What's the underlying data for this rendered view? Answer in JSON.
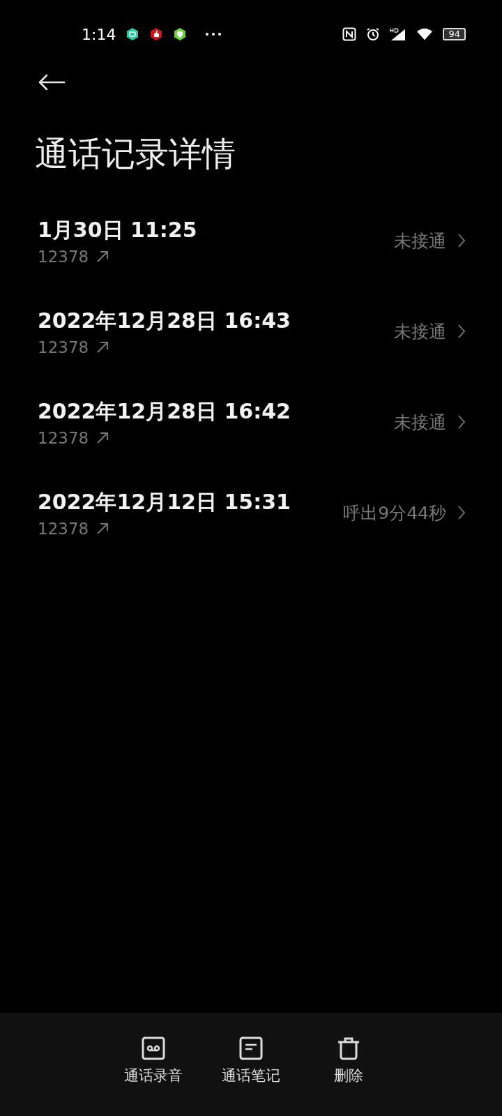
{
  "status_bar": {
    "time": "1:14",
    "battery": "94"
  },
  "title": "通话记录详情",
  "calls": [
    {
      "datetime": "1月30日 11:25",
      "number": "12378",
      "status": "未接通"
    },
    {
      "datetime": "2022年12月28日 16:43",
      "number": "12378",
      "status": "未接通"
    },
    {
      "datetime": "2022年12月28日 16:42",
      "number": "12378",
      "status": "未接通"
    },
    {
      "datetime": "2022年12月12日 15:31",
      "number": "12378",
      "status": "呼出9分44秒"
    }
  ],
  "actions": [
    {
      "kind": "recording",
      "label": "通话录音"
    },
    {
      "kind": "notes",
      "label": "通话笔记"
    },
    {
      "kind": "delete",
      "label": "删除"
    }
  ]
}
